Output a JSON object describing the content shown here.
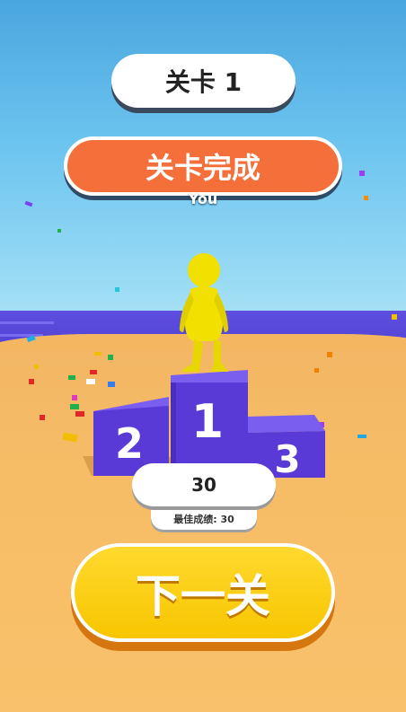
{
  "hud": {
    "level_label": "关卡 1",
    "status_banner": "关卡完成",
    "player_name": "You"
  },
  "podium": {
    "first": "1",
    "second": "2",
    "third": "3"
  },
  "results": {
    "score": "30",
    "best_score": "最佳成绩: 30"
  },
  "actions": {
    "next_level_label": "下一关"
  },
  "colors": {
    "banner_orange": "#f56f3a",
    "podium_purple": "#5a3ad6",
    "player_yellow": "#f2e000",
    "button_yellow": "#f7c600",
    "button_shadow": "#d6760f"
  }
}
